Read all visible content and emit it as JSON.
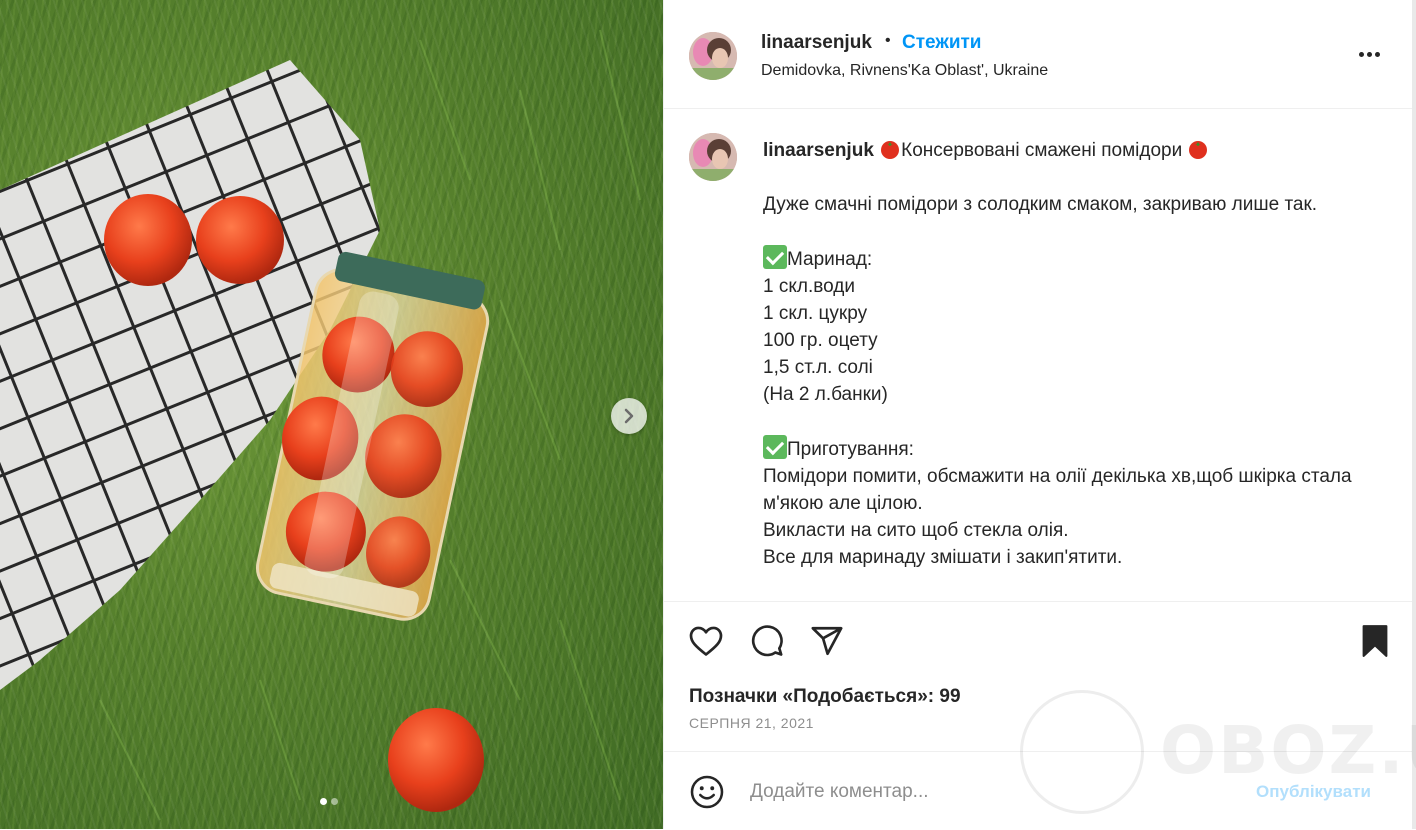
{
  "post": {
    "username": "linaarsenjuk",
    "separator": "•",
    "follow_label": "Стежити",
    "location": "Demidovka, Rivnens'Ka Oblast', Ukraine"
  },
  "caption": {
    "username": "linaarsenjuk",
    "title": "Консервовані смажені помідори",
    "intro": "Дуже смачні помідори з солодким смаком, закриваю лише так.",
    "marinade_heading": "Маринад:",
    "marinade_lines": [
      "1 скл.води",
      "1 скл. цукру",
      "100 гр. оцету",
      "1,5 ст.л. солі",
      "(На 2 л.банки)"
    ],
    "prep_heading": "Приготування:",
    "prep_lines": [
      "Помідори помити, обсмажити на олії декілька хв,щоб шкірка стала м'якою але цілою.",
      "Викласти на сито щоб стекла олія.",
      "Все для маринаду змішати і закип'ятити."
    ]
  },
  "actions": {
    "like_icon": "heart-icon",
    "comment_icon": "comment-icon",
    "share_icon": "paper-plane-icon",
    "save_icon": "bookmark-icon"
  },
  "likes_text": "Позначки «Подобається»: 99",
  "date_text": "СЕРПНЯ 21, 2021",
  "comment": {
    "placeholder": "Додайте коментар...",
    "publish_label": "Опублікувати"
  },
  "watermark": "OBOZ.UA",
  "carousel": {
    "total": 2,
    "active": 1
  },
  "colors": {
    "accent": "#0095f6",
    "publish_disabled": "#b2dffc",
    "text": "#262626",
    "muted": "#8e8e8e"
  }
}
